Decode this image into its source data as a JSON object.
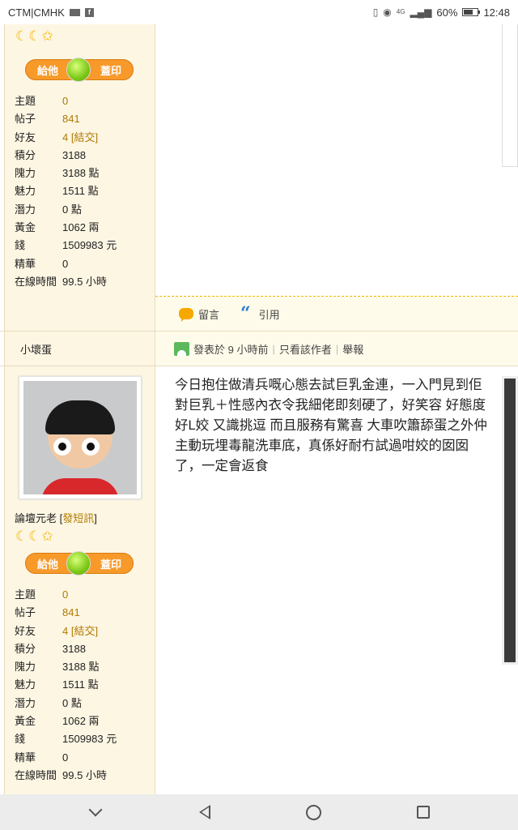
{
  "status_bar": {
    "carrier": "CTM|CMHK",
    "network": "4G",
    "battery": "60%",
    "battery_level": 0.6,
    "time": "12:48"
  },
  "post1": {
    "user": {
      "stamp": {
        "left": "給他",
        "right": "蓋印"
      },
      "stats": [
        {
          "key": "主題",
          "value": "0",
          "style": "orange"
        },
        {
          "key": "帖子",
          "value": "841",
          "style": "orange"
        },
        {
          "key": "好友",
          "value": "4",
          "style": "orange",
          "link": "結交"
        },
        {
          "key": "積分",
          "value": "3188"
        },
        {
          "key": "隗力",
          "value": "3188 點"
        },
        {
          "key": "魅力",
          "value": "1511 點"
        },
        {
          "key": "潛力",
          "value": "0 點"
        },
        {
          "key": "黃金",
          "value": "1062 兩"
        },
        {
          "key": "錢",
          "value": "1509983 元"
        },
        {
          "key": "精華",
          "value": "0"
        },
        {
          "key": "在線時間",
          "value": "99.5 小時"
        }
      ]
    },
    "actions": {
      "comment": "留言",
      "quote": "引用"
    }
  },
  "post2": {
    "username": "小壞蛋",
    "meta": {
      "posted": "發表於 9 小時前",
      "only_author": "只看該作者",
      "report": "舉報"
    },
    "user": {
      "title": "論壇元老",
      "send_message": "發短訊",
      "stamp": {
        "left": "給他",
        "right": "蓋印"
      },
      "stats": [
        {
          "key": "主題",
          "value": "0",
          "style": "orange"
        },
        {
          "key": "帖子",
          "value": "841",
          "style": "orange"
        },
        {
          "key": "好友",
          "value": "4",
          "style": "orange",
          "link": "結交"
        },
        {
          "key": "積分",
          "value": "3188"
        },
        {
          "key": "隗力",
          "value": "3188 點"
        },
        {
          "key": "魅力",
          "value": "1511 點"
        },
        {
          "key": "潛力",
          "value": "0 點"
        },
        {
          "key": "黃金",
          "value": "1062 兩"
        },
        {
          "key": "錢",
          "value": "1509983 元"
        },
        {
          "key": "精華",
          "value": "0"
        },
        {
          "key": "在線時間",
          "value": "99.5 小時"
        }
      ]
    },
    "content": "今日抱住做清兵嘅心態去試巨乳金連，一入門見到佢對巨乳＋性感內衣令我細佬即刻硬了，好笑容 好態度 好L姣 又識挑逗 而且服務有驚喜 大車吹簫舔蛋之外仲主動玩埋毒龍洗車底，真係好耐冇試過咁姣的囡囡了，一定會返食"
  },
  "icons": {
    "mail": "mail-icon",
    "facebook": "facebook-icon",
    "vibrate": "vibrate-icon",
    "eye": "eye-comfort-icon",
    "signal": "signal-icon",
    "battery": "battery-icon",
    "moon": "moon-icon",
    "star": "star-icon",
    "comment": "comment-bubble-icon",
    "quote": "quote-icon",
    "user": "user-icon"
  }
}
